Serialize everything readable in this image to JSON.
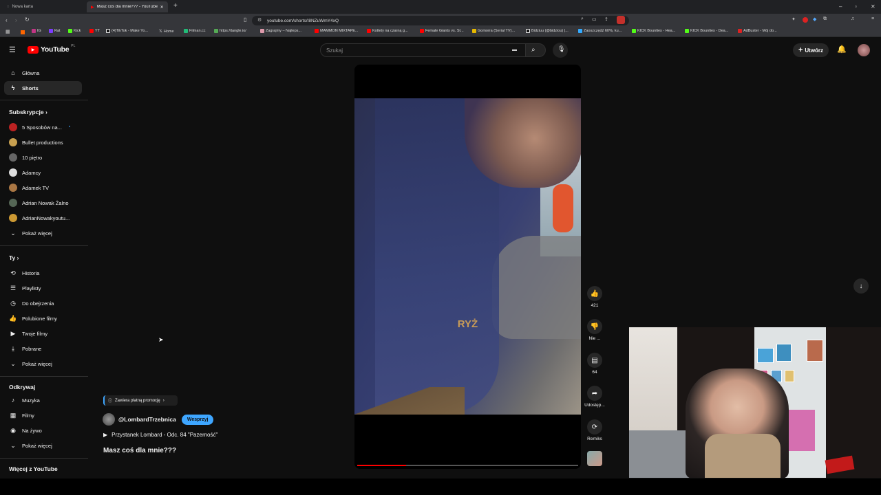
{
  "browser": {
    "tabs": [
      {
        "label": "Nowa karta"
      },
      {
        "label": "Masz coś dla mnie??? - YouTube"
      }
    ],
    "url": "youtube.com/shorts/I8NZuWmY4xQ",
    "bookmarks": [
      "IG",
      "Rat",
      "Kick",
      "YT",
      "(4)TikTok - Make Yo...",
      "Home",
      "Filman.cc",
      "https://tangle.io/",
      "Zagrajmy – Najleps...",
      "MAMMON MIXTAPE...",
      "Kotlety na czarną g...",
      "Female Giants vs. St...",
      "Gomorra (Serial TV)...",
      "Bidziuu (@bidziou) |...",
      "Zaoszczędź 60%, ku...",
      "KICK Bounties - Hea...",
      "KICK Bounties - Dea...",
      "AdBuster - Mój do..."
    ]
  },
  "header": {
    "logo": "YouTube",
    "logo_region": "PL",
    "search_placeholder": "Szukaj",
    "create_label": "Utwórz"
  },
  "sidebar": {
    "main": [
      {
        "label": "Główna",
        "icon": "home-icon"
      },
      {
        "label": "Shorts",
        "icon": "shorts-icon"
      }
    ],
    "subs_heading": "Subskrypcje",
    "subs": [
      {
        "label": "5 Sposobów na...",
        "color": "#b22"
      },
      {
        "label": "Bullet productions",
        "color": "#c8a050"
      },
      {
        "label": "10 piętro",
        "color": "#666"
      },
      {
        "label": "Adamcy",
        "color": "#ddd"
      },
      {
        "label": "Adamek TV",
        "color": "#aa7744"
      },
      {
        "label": "Adrian Nowak Żalno",
        "color": "#556655"
      },
      {
        "label": "AdrianNowakyoutu...",
        "color": "#cc9933"
      }
    ],
    "subs_more": "Pokaż więcej",
    "you_heading": "Ty",
    "you": [
      {
        "label": "Historia",
        "icon": "history-icon",
        "glyph": "⟲"
      },
      {
        "label": "Playlisty",
        "icon": "playlist-icon",
        "glyph": "☰"
      },
      {
        "label": "Do obejrzenia",
        "icon": "clock-icon",
        "glyph": "◷"
      },
      {
        "label": "Polubione filmy",
        "icon": "like-icon",
        "glyph": "👍"
      },
      {
        "label": "Twoje filmy",
        "icon": "video-icon",
        "glyph": "▶"
      },
      {
        "label": "Pobrane",
        "icon": "download-icon",
        "glyph": "⤓"
      }
    ],
    "you_more": "Pokaż więcej",
    "explore_heading": "Odkrywaj",
    "explore": [
      {
        "label": "Muzyka",
        "icon": "music-icon",
        "glyph": "♪"
      },
      {
        "label": "Filmy",
        "icon": "film-icon",
        "glyph": "▦"
      },
      {
        "label": "Na żywo",
        "icon": "live-icon",
        "glyph": "◉"
      }
    ],
    "explore_more": "Pokaż więcej",
    "more_heading": "Więcej z YouTube"
  },
  "short": {
    "caption": "RYŻ",
    "progress": 0.22,
    "likes": "421",
    "dislike_label": "Nie ...",
    "comments": "64",
    "share_label": "Udostęp...",
    "remix_label": "Remiks",
    "promo_label": "Zawiera płatną promocję",
    "channel": "@LombardTrzebnica",
    "support_label": "Wesprzyj",
    "playlist": "Przystanek Lombard - Odc. 84 \"Pazerność\"",
    "title": "Masz coś dla mnie???"
  }
}
